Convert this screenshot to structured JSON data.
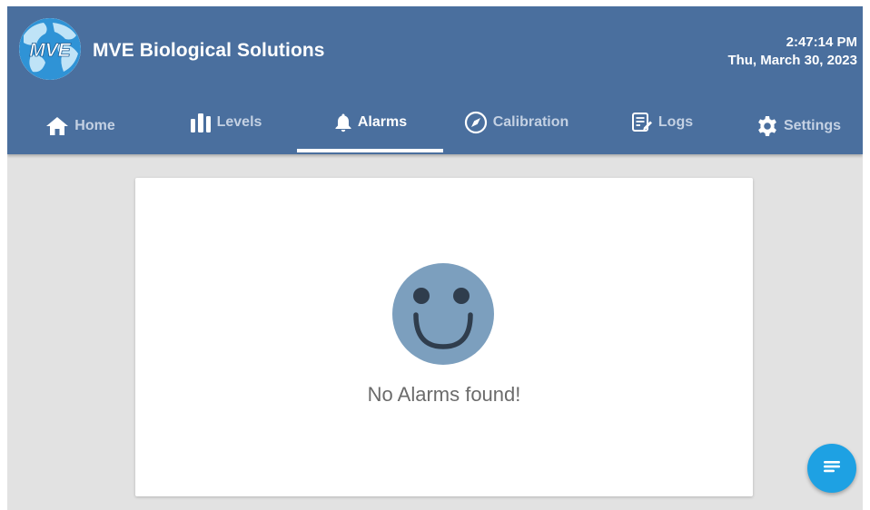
{
  "header": {
    "logo_text": "MVE",
    "title": "MVE Biological Solutions",
    "time": "2:47:14 PM",
    "date": "Thu, March 30, 2023"
  },
  "tabs": [
    {
      "label": "Home",
      "icon": "home-icon"
    },
    {
      "label": "Levels",
      "icon": "bar-chart-icon"
    },
    {
      "label": "Alarms",
      "icon": "bell-icon",
      "active": true
    },
    {
      "label": "Calibration",
      "icon": "compass-icon"
    },
    {
      "label": "Logs",
      "icon": "edit-document-icon"
    },
    {
      "label": "Settings",
      "icon": "gear-icon"
    }
  ],
  "alarms": {
    "empty_icon": "smiley-face-icon",
    "empty_message": "No Alarms found!"
  },
  "fab": {
    "icon": "notes-menu-icon"
  },
  "colors": {
    "header": "#4a6f9e",
    "tab_inactive": "#c4d1e3",
    "tab_active": "#ffffff",
    "background": "#e2e2e2",
    "smiley": "#7c9fbe",
    "fab": "#1ea1e3"
  }
}
